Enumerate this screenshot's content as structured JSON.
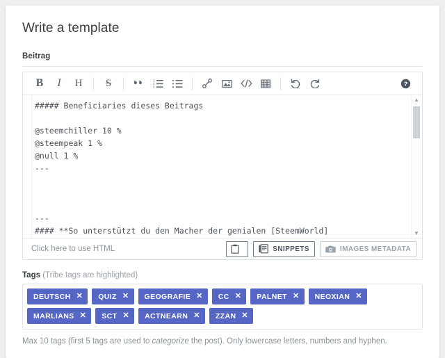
{
  "page": {
    "title": "Write a template"
  },
  "editor_field": {
    "label": "Beitrag",
    "toolbar": [
      {
        "name": "bold-icon",
        "glyph": "B"
      },
      {
        "name": "italic-icon",
        "glyph": "I"
      },
      {
        "name": "heading-icon",
        "glyph": "H"
      },
      {
        "name": "strikethrough-icon",
        "glyph": "S"
      },
      {
        "name": "blockquote-icon",
        "glyph": "“"
      },
      {
        "name": "ordered-list-icon",
        "glyph": "1."
      },
      {
        "name": "unordered-list-icon",
        "glyph": "•"
      },
      {
        "name": "link-icon",
        "glyph": "🔗"
      },
      {
        "name": "image-icon",
        "glyph": "🖼"
      },
      {
        "name": "code-icon",
        "glyph": "</>"
      },
      {
        "name": "table-icon",
        "glyph": "▦"
      },
      {
        "name": "undo-icon",
        "glyph": "↶"
      },
      {
        "name": "redo-icon",
        "glyph": "↷"
      },
      {
        "name": "help-icon",
        "glyph": "?"
      }
    ],
    "content": "##### Beneficiaries dieses Beitrags\n\n@steemchiller 10 %\n@steempeak 1 %\n@null 1 %\n---\n\n\n\n---\n#### **So unterstützt du den Macher der genialen [SteemWorld]",
    "footer": {
      "html_link": "Click here to use HTML",
      "clipboard_button_label": "",
      "snippets_button_label": "SNIPPETS",
      "images_metadata_button_label": "IMAGES METADATA"
    }
  },
  "tags_field": {
    "label": "Tags",
    "label_note": "(Tribe tags are highlighted)",
    "chips": [
      {
        "label": "DEUTSCH"
      },
      {
        "label": "QUIZ"
      },
      {
        "label": "GEOGRAFIE"
      },
      {
        "label": "CC"
      },
      {
        "label": "PALNET"
      },
      {
        "label": "NEOXIAN"
      },
      {
        "label": "MARLIANS"
      },
      {
        "label": "SCT"
      },
      {
        "label": "ACTNEARN"
      },
      {
        "label": "ZZAN"
      }
    ],
    "remove_glyph": "✕",
    "hint_prefix": "Max 10 tags (first 5 tags are used to ",
    "hint_italic": "categorize",
    "hint_suffix": " the post). Only lowercase letters, numbers and hyphen."
  },
  "colors": {
    "chip_background": "#5566c4",
    "page_background": "#eceef0",
    "card_background": "#ffffff",
    "border": "#dfe2e5",
    "muted_text": "#8b9299"
  }
}
